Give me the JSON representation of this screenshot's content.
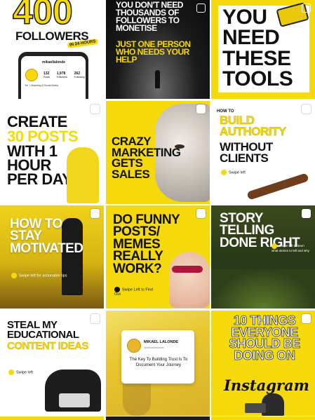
{
  "grid": {
    "tiles": [
      {
        "title": "400",
        "sub": "FOLLOWERS",
        "badge": "IN 24 HOURS",
        "profile_name": "mikaellalonde",
        "stats": [
          "132",
          "1,978",
          "262"
        ],
        "stat_labels": [
          "Posts",
          "Followers",
          "Following"
        ],
        "bio": "Mr. L Branding & Social Media"
      },
      {
        "text1": "YOU DON'T NEED THOUSANDS OF FOLLOWERS TO MONETISE",
        "text2": "JUST ONE PERSON WHO NEEDS YOUR HELP"
      },
      {
        "text": "YOU NEED THESE TOOLS"
      },
      {
        "text1": "CREATE",
        "text2": "30 POSTS",
        "text3": "WITH 1 HOUR PER DAY"
      },
      {
        "text": "CRAZY MARKETING GETS SALES"
      },
      {
        "howto": "HOW TO",
        "text1": "BUILD AUTHORITY",
        "text2": "WITHOUT CLIENTS",
        "swipe": "Swipe left"
      },
      {
        "text": "HOW TO STAY MOTIVATED",
        "swipe": "Swipe left for actionable tips"
      },
      {
        "text": "DO FUNNY POSTS/ MEMES REALLY WORK?",
        "swipe": "Swipe Left to Find Out"
      },
      {
        "text": "STORY TELLING DONE RIGHT",
        "swipe": "Swipe left to learn what stories to tell and why"
      },
      {
        "text1": "STEAL MY EDUCATIONAL",
        "text2": "CONTENT IDEAS",
        "swipe": "Swipe left"
      },
      {
        "name": "MIKAEL LALONDE",
        "handle": "@mikaellalonde",
        "quote": "The Key To Building Trust Is To Document Your Journey"
      },
      {
        "text": "10 THINGS EVERYONE SHOULD BE DOING ON",
        "script": "Instagram"
      }
    ]
  },
  "colors": {
    "yellow": "#f5d90a",
    "black": "#111111"
  }
}
